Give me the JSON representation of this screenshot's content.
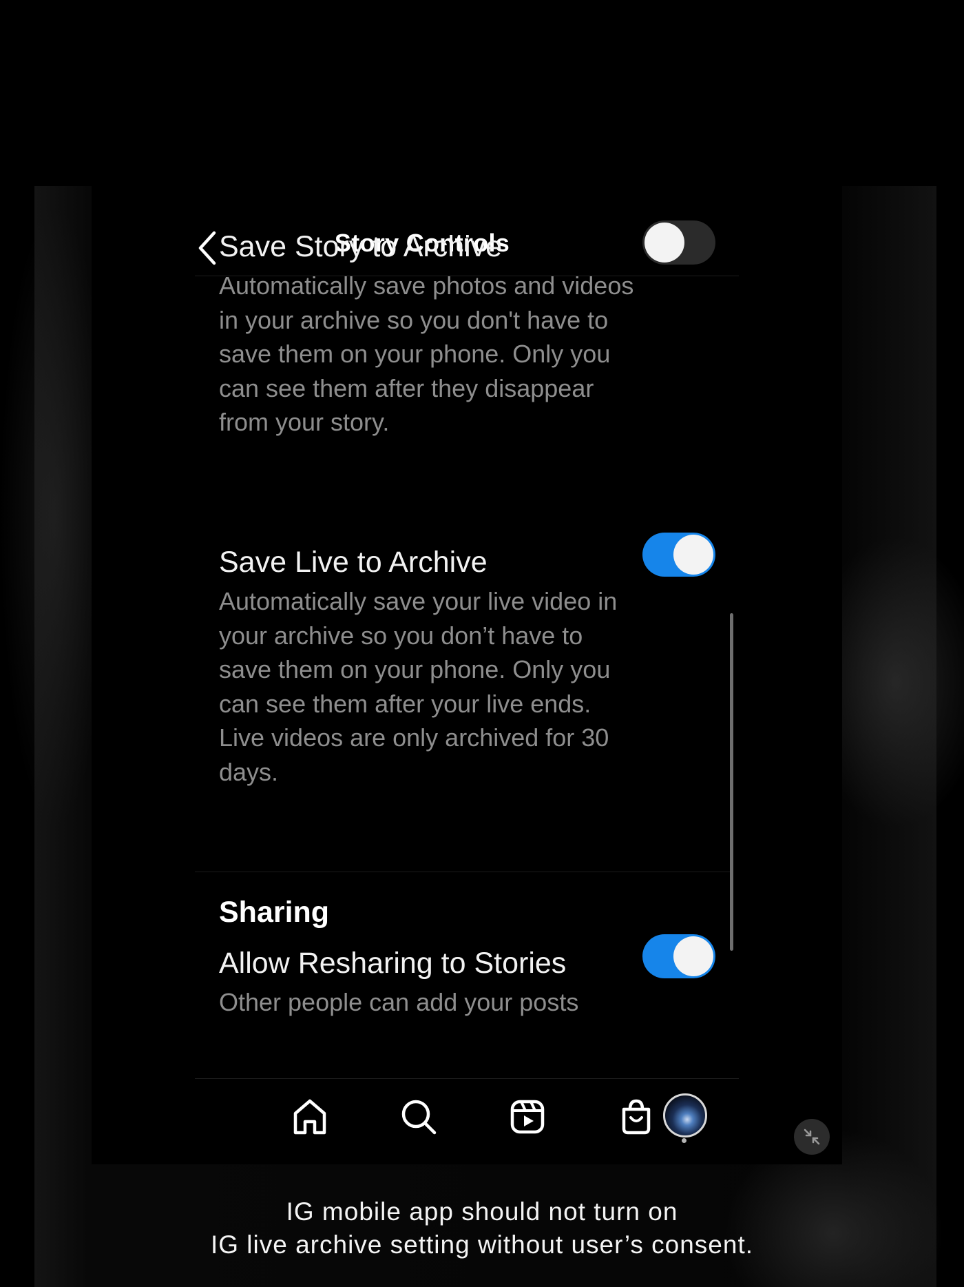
{
  "header": {
    "title": "Story Controls"
  },
  "settings": [
    {
      "title": "Save Story to Archive",
      "description": "Automatically save photos and videos in your archive so you don't have to save them on your phone. Only you can see them after they disappear from your story.",
      "enabled": false
    },
    {
      "title": "Save Live to Archive",
      "description": "Automatically save your live video in your archive so you don’t have to save them on your phone. Only you can see them after your live ends. Live videos are only archived for 30 days.",
      "enabled": true
    }
  ],
  "sharing": {
    "section_title": "Sharing",
    "items": [
      {
        "title": "Allow Resharing to Stories",
        "description": "Other people can add your posts",
        "enabled": true
      }
    ]
  },
  "tabbar": {
    "tabs": [
      "home-icon",
      "search-icon",
      "reels-icon",
      "shop-icon",
      "profile-avatar"
    ]
  },
  "caption": {
    "line1": "IG mobile app should not turn on",
    "line2": "IG live archive setting without user’s consent."
  },
  "colors": {
    "toggle_on": "#1685ea",
    "toggle_off": "#2b2b2b",
    "background": "#000000",
    "description_text": "#8e8e8e"
  }
}
